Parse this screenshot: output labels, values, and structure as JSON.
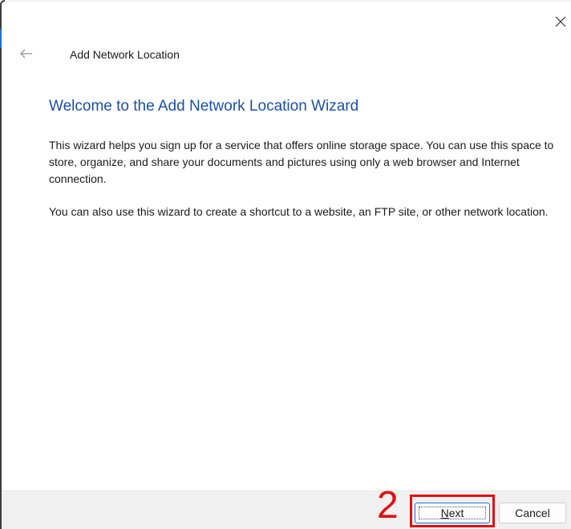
{
  "window": {
    "title": "Add Network Location",
    "close_icon": "close-icon",
    "back_icon": "back-arrow-icon"
  },
  "main": {
    "heading": "Welcome to the Add Network Location Wizard",
    "paragraph1": "This wizard helps you sign up for a service that offers online storage space.  You can use this space to store, organize, and share your documents and pictures using only a web browser and Internet connection.",
    "paragraph2": "You can also use this wizard to create a shortcut to a website, an FTP site, or other network location."
  },
  "footer": {
    "next_mnemonic": "N",
    "next_rest": "ext",
    "cancel_label": "Cancel"
  },
  "annotation": {
    "step_number": "2",
    "color": "#e01010"
  },
  "colors": {
    "heading": "#1a4fa8",
    "accent": "#1f6fd1",
    "footer_bg": "#f0f0f0"
  }
}
